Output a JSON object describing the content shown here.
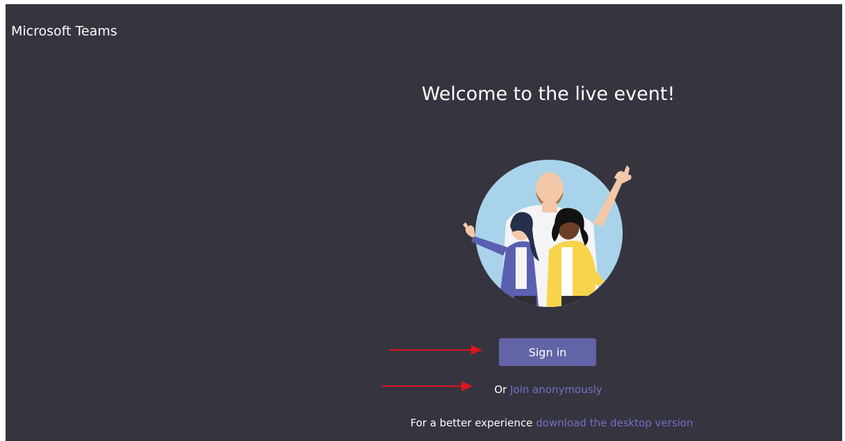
{
  "app": {
    "title": "Microsoft Teams"
  },
  "main": {
    "welcome_heading": "Welcome to the live event!",
    "signin_label": "Sign in",
    "anonymous_prefix": "Or",
    "anonymous_link": "Join anonymously",
    "desktop_prefix": "For a better experience",
    "desktop_link": "download the desktop version"
  },
  "colors": {
    "background": "#36343f",
    "primary_button": "#6264a7",
    "link": "#6f72c2",
    "annotation_arrow": "#e0161b"
  },
  "icons": {
    "illustration": "three-people-waving-illustration",
    "annotation": "red-arrow-icon"
  }
}
